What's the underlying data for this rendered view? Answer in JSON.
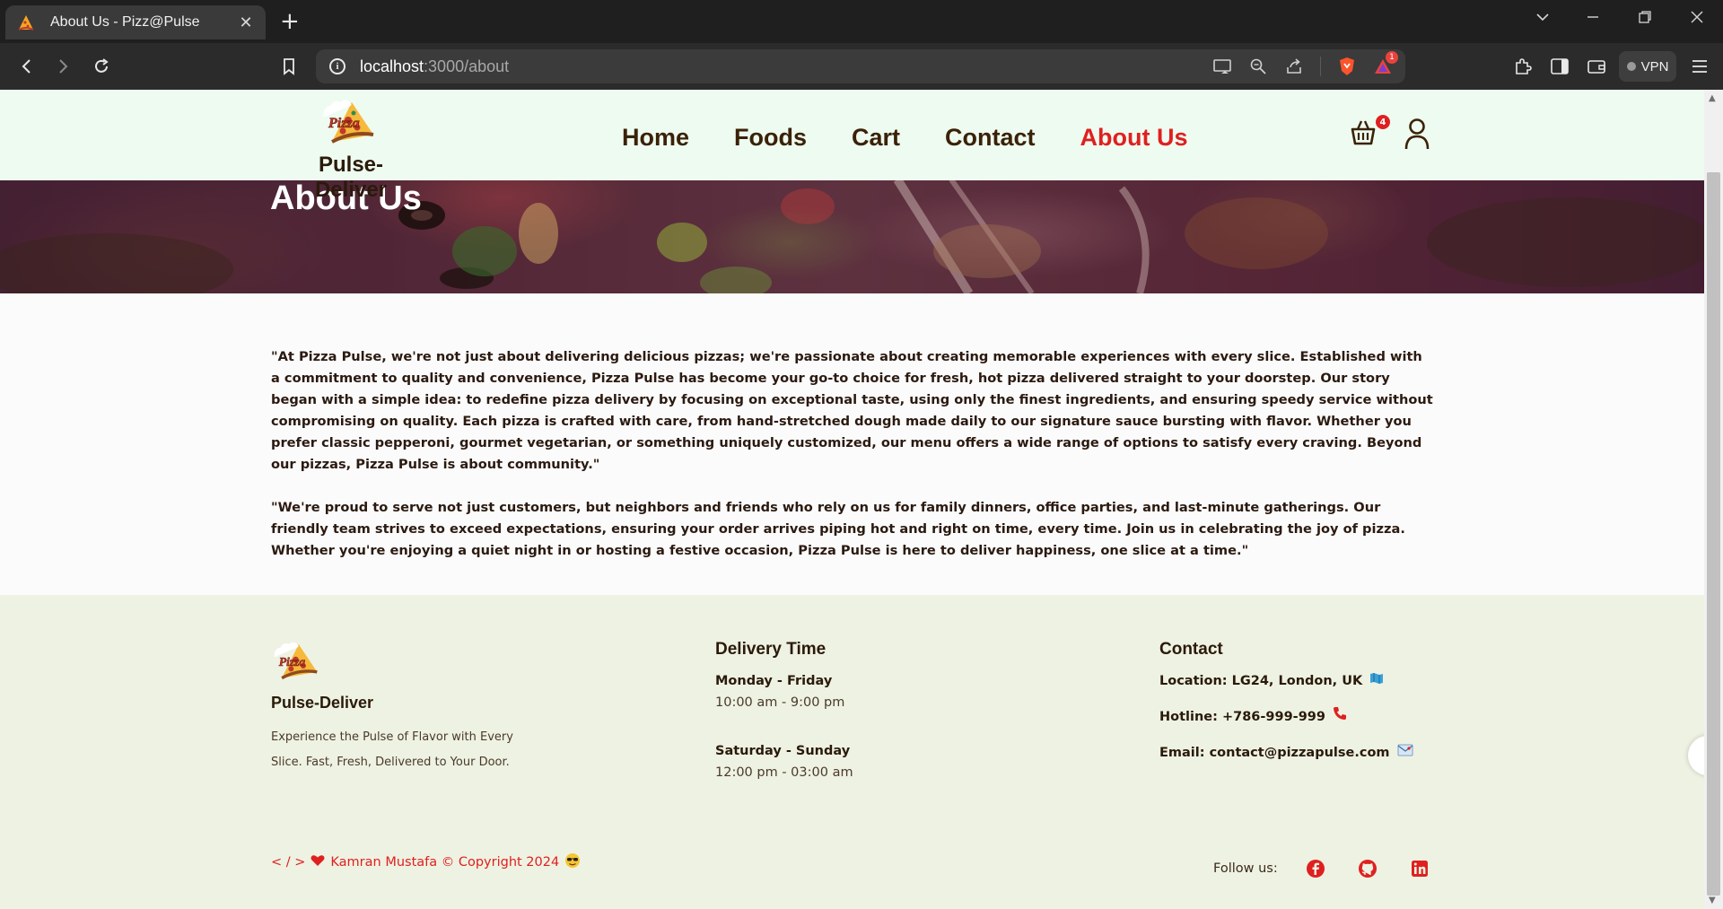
{
  "browser": {
    "tab_title": "About Us - Pizz@Pulse",
    "url_host": "localhost",
    "url_path": ":3000/about",
    "vpn_label": "VPN",
    "rewards_badge": "1"
  },
  "header": {
    "brand": "Pulse-Deliver",
    "nav": [
      {
        "label": "Home"
      },
      {
        "label": "Foods"
      },
      {
        "label": "Cart"
      },
      {
        "label": "Contact"
      },
      {
        "label": "About Us",
        "active": true
      }
    ],
    "cart_count": "4",
    "accent_color": "#df2020"
  },
  "hero": {
    "title": "About Us"
  },
  "about": {
    "paragraphs": [
      "\"At Pizza Pulse, we're not just about delivering delicious pizzas; we're passionate about creating memorable experiences with every slice. Established with a commitment to quality and convenience, Pizza Pulse has become your go-to choice for fresh, hot pizza delivered straight to your doorstep. Our story began with a simple idea: to redefine pizza delivery by focusing on exceptional taste, using only the finest ingredients, and ensuring speedy service without compromising on quality. Each pizza is crafted with care, from hand-stretched dough made daily to our signature sauce bursting with flavor. Whether you prefer classic pepperoni, gourmet vegetarian, or something uniquely customized, our menu offers a wide range of options to satisfy every craving. Beyond our pizzas, Pizza Pulse is about community.\"",
      "\"We're proud to serve not just customers, but neighbors and friends who rely on us for family dinners, office parties, and last-minute gatherings. Our friendly team strives to exceed expectations, ensuring your order arrives piping hot and right on time, every time. Join us in celebrating the joy of pizza. Whether you're enjoying a quiet night in or hosting a festive occasion, Pizza Pulse is here to deliver happiness, one slice at a time.\""
    ]
  },
  "footer": {
    "brand": "Pulse-Deliver",
    "description": "Experience the Pulse of Flavor with Every Slice. Fast, Fresh, Delivered to Your Door.",
    "delivery": {
      "heading": "Delivery Time",
      "weekday_label": "Monday - Friday",
      "weekday_hours": "10:00 am - 9:00 pm",
      "weekend_label": "Saturday - Sunday",
      "weekend_hours": "12:00 pm - 03:00 am"
    },
    "contact": {
      "heading": "Contact",
      "location": "Location: LG24, London, UK",
      "hotline": "Hotline: +786-999-999",
      "email": "Email: contact@pizzapulse.com"
    },
    "copyright_prefix": "< / >",
    "copyright_text": "Kamran Mustafa © Copyright 2024",
    "follow_label": "Follow us:",
    "social": [
      "facebook-icon",
      "github-icon",
      "linkedin-icon"
    ]
  }
}
